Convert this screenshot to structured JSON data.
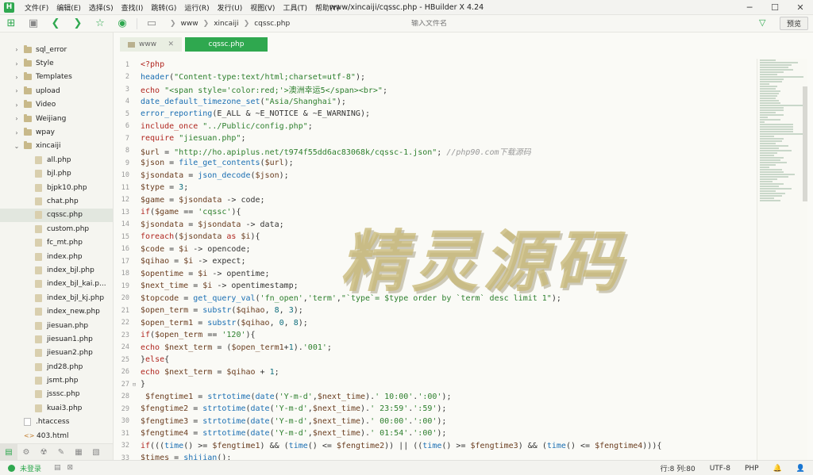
{
  "app": {
    "logo": "H",
    "window_title": "www/xincaiji/cqssc.php - HBuilder X 4.24",
    "menu": [
      "文件(F)",
      "编辑(E)",
      "选择(S)",
      "查找(I)",
      "跳转(G)",
      "运行(R)",
      "发行(U)",
      "视图(V)",
      "工具(T)",
      "帮助(Y)"
    ],
    "win_min": "─",
    "win_max": "☐",
    "win_close": "✕"
  },
  "toolbar": {
    "breadcrumb": [
      "www",
      "xincaiji",
      "cqssc.php"
    ],
    "search_placeholder": "输入文件名",
    "preview_label": "预览"
  },
  "sidebar": {
    "folders": [
      {
        "label": "sql_error"
      },
      {
        "label": "Style"
      },
      {
        "label": "Templates"
      },
      {
        "label": "upload"
      },
      {
        "label": "Video"
      },
      {
        "label": "Weijiang"
      },
      {
        "label": "wpay"
      },
      {
        "label": "xincaiji"
      }
    ],
    "files": [
      "all.php",
      "bjl.php",
      "bjpk10.php",
      "chat.php",
      "cqssc.php",
      "custom.php",
      "fc_mt.php",
      "index.php",
      "index_bjl.php",
      "index_bjl_kai.p...",
      "index_bjl_kj.php",
      "index_new.php",
      "jiesuan.php",
      "jiesuan1.php",
      "jiesuan2.php",
      "jnd28.php",
      "jsmt.php",
      "jsssc.php",
      "kuai3.php"
    ],
    "active_file": "cqssc.php",
    "root_files": [
      ".htaccess",
      "403.html"
    ]
  },
  "tabs": [
    {
      "label": "www",
      "close": "✕",
      "active": false
    },
    {
      "label": "cqssc.php",
      "active": true
    }
  ],
  "code": {
    "line_numbers": [
      "1",
      "2",
      "3",
      "4",
      "5",
      "6",
      "7",
      "8",
      "9",
      "10",
      "11",
      "12",
      "13",
      "14",
      "15",
      "16",
      "17",
      "18",
      "19",
      "20",
      "21",
      "22",
      "23",
      "24",
      "25",
      "26",
      "27",
      "28",
      "29",
      "30",
      "31",
      "32",
      "33"
    ],
    "lines": [
      "<?php",
      "header(\"Content-type:text/html;charset=utf-8\");",
      "echo \"<span style='color:red;'>澳洲幸运5</span><br>\";",
      "date_default_timezone_set(\"Asia/Shanghai\");",
      "error_reporting(E_ALL & ~E_NOTICE & ~E_WARNING);",
      "include_once \"../Public/config.php\";",
      "require \"jiesuan.php\";",
      "$url = \"http://ho.apiplus.net/t974f55dd6ac83068k/cqssc-1.json\"; //php90.com下载源码",
      "$json = file_get_contents($url);",
      "$jsondata = json_decode($json);",
      "$type = 3;",
      "$game = $jsondata -> code;",
      "if($game == 'cqssc'){",
      "$jsondata = $jsondata -> data;",
      "foreach($jsondata as $i){",
      "$code = $i -> opencode;",
      "$qihao = $i -> expect;",
      "$opentime = $i -> opentime;",
      "$next_time = $i -> opentimestamp;",
      "$topcode = get_query_val('fn_open','term',\"`type`= $type order by `term` desc limit 1\");",
      "$open_term = substr($qihao, 8, 3);",
      "$open_term1 = substr($qihao, 0, 8);",
      "if($open_term == '120'){",
      "echo $next_term = ($open_term1+1).'001';",
      "}else{",
      "echo $next_term = $qihao + 1;",
      "}",
      " $fengtime1 = strtotime(date('Y-m-d',$next_time).' 10:00'.':00');",
      "$fengtime2 = strtotime(date('Y-m-d',$next_time).' 23:59'.':59');",
      "$fengtime3 = strtotime(date('Y-m-d',$next_time).' 00:00'.':00');",
      "$fengtime4 = strtotime(date('Y-m-d',$next_time).' 01:54'.':00');",
      "if(((time() >= $fengtime1) && (time() <= $fengtime2)) || ((time() >= $fengtime3) && (time() <= $fengtime4))){",
      "$times = shijian();"
    ],
    "fold_marker": "⊟"
  },
  "watermark": "精灵源码",
  "status": {
    "login": "未登录",
    "position": "行:8  列:80",
    "encoding": "UTF-8",
    "language": "PHP",
    "bell": "🔔",
    "user": "👤"
  }
}
